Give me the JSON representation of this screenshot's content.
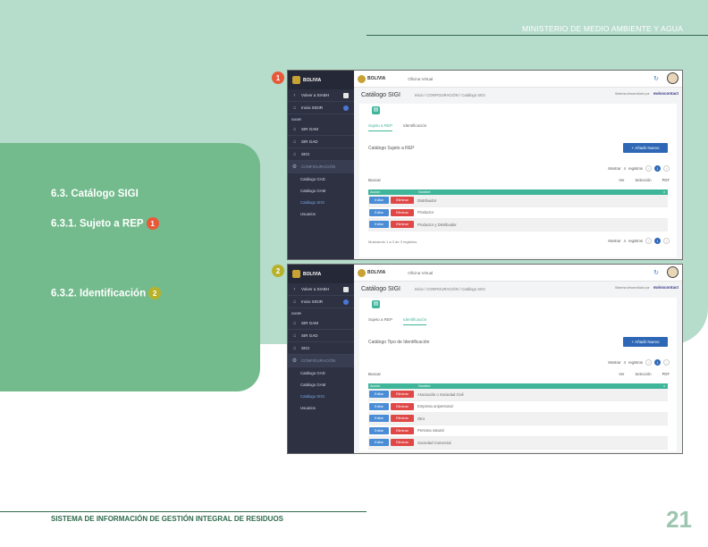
{
  "page": {
    "ministry": "MINISTERIO DE MEDIO AMBIENTE Y AGUA",
    "footer": "SISTEMA DE INFORMACIÓN DE GESTIÓN INTEGRAL DE RESIDUOS",
    "page_number": "21",
    "sections": {
      "s1": "6.3. Catálogo SIGI",
      "s2": "6.3.1. Sujeto a REP",
      "s3": "6.3.2. Identificación",
      "badge1": "1",
      "badge2": "2"
    },
    "colors": {
      "badge1": "#e8593a",
      "badge2": "#b7b22a",
      "accent": "#3fb59a",
      "primary": "#2e67b5"
    }
  },
  "app": {
    "brand": "BOLIVIA",
    "office": "Oficina Virtual",
    "page_title": "Catálogo SIGI",
    "breadcrumb": "Inicio / CONFIGURACIÓN / Catálogo SIGI",
    "developed_by": "Sistema desarrollado por",
    "swiss": "swisscontact",
    "sidebar": {
      "back": "Volver a SIABH",
      "home": "Inicio SIGIR",
      "cap": "SIGIR",
      "items": [
        "SIR GAM",
        "SIR GAD",
        "SIGI"
      ],
      "config": "CONFIGURACIÓN",
      "subs": [
        "Catálogo GAD",
        "Catálogo GAM",
        "Catálogo SIGI",
        "Usuarios"
      ]
    },
    "tabs": [
      "Sujeto a REP",
      "Identificación"
    ],
    "add_button": "+ Añadir Nuevo",
    "show": "Mostrar",
    "show_count": "4",
    "records": "registros",
    "search": "Buscar",
    "export": [
      "Ver",
      "Selección",
      "PDF"
    ],
    "col_action": "Acción",
    "col_name": "Nombre",
    "edit": "Editar",
    "delete": "Eliminar",
    "prev": "‹",
    "next": "›",
    "page_cur": "1"
  },
  "screens": [
    {
      "card_title": "Catálogo Sujeto a REP",
      "rows": [
        "Distribuidor",
        "Productor",
        "Productor y Distribuidor"
      ],
      "info": "Mostrando 1 a 3 de 3 registros"
    },
    {
      "card_title": "Catálogo Tipo de Identificación",
      "rows": [
        "Asociación o Sociedad Civil",
        "Empresa unipersonal",
        "Otro",
        "Persona natural",
        "Sociedad Comercial"
      ],
      "info": ""
    }
  ]
}
